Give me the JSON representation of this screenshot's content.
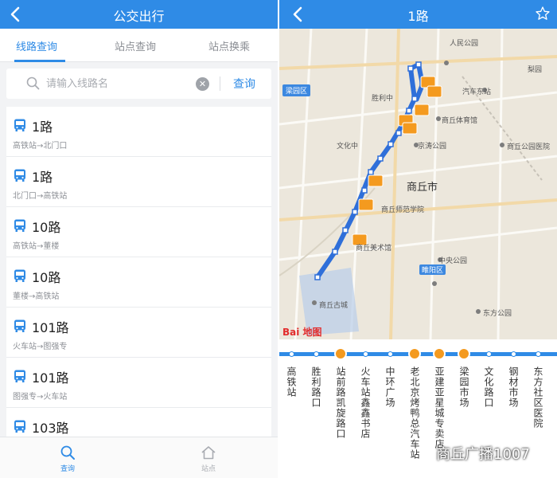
{
  "left": {
    "header": {
      "title": "公交出行"
    },
    "tabs": [
      {
        "label": "线路查询",
        "active": true
      },
      {
        "label": "站点查询",
        "active": false
      },
      {
        "label": "站点换乘",
        "active": false
      }
    ],
    "search": {
      "placeholder": "请输入线路名",
      "value": "",
      "button": "查询"
    },
    "routes": [
      {
        "name": "1路",
        "direction": "高铁站→北门口"
      },
      {
        "name": "1路",
        "direction": "北门口→高铁站"
      },
      {
        "name": "10路",
        "direction": "高铁站→董楼"
      },
      {
        "name": "10路",
        "direction": "董楼→高铁站"
      },
      {
        "name": "101路",
        "direction": "火车站→图强专"
      },
      {
        "name": "101路",
        "direction": "图强专→火车站"
      },
      {
        "name": "103路",
        "direction": ""
      }
    ],
    "bottom_nav": [
      {
        "label": "查询",
        "icon": "search-icon",
        "active": true
      },
      {
        "label": "站点",
        "icon": "home-icon",
        "active": false
      }
    ],
    "accent": "#2f8be6"
  },
  "right": {
    "header": {
      "title": "1路"
    },
    "map": {
      "labels": {
        "district": "梁园区",
        "city": "商丘市",
        "wenhua": "文化中",
        "jiyuan": "京涛公园",
        "yiyuan": "商丘公园医院",
        "jinshijian": "人民公园",
        "cheshi": "汽车东站",
        "zhuanhuan": "商丘体育馆",
        "meishuguan": "商丘美术馆",
        "shifan": "商丘师范学院",
        "gucheng": "商丘古城",
        "zhongxin": "中央公园",
        "dongfang": "东方公园",
        "liyuan": "梨园",
        "shengli": "胜利中"
      },
      "badge_nancheng": "睢阳区",
      "logo_text": "Bai 地图"
    },
    "stops": [
      {
        "name": "高铁站",
        "bus": false
      },
      {
        "name": "胜利路口",
        "bus": false
      },
      {
        "name": "站前路凯旋路口",
        "bus": true
      },
      {
        "name": "火车站鑫鑫书店",
        "bus": false
      },
      {
        "name": "中环广场",
        "bus": false
      },
      {
        "name": "老北京烤鸭总汽车站",
        "bus": true
      },
      {
        "name": "亚建亚星城专卖店",
        "bus": true
      },
      {
        "name": "梁园市场",
        "bus": true
      },
      {
        "name": "文化路口",
        "bus": false
      },
      {
        "name": "钢材市场",
        "bus": false
      },
      {
        "name": "东方社区医院",
        "bus": false
      }
    ],
    "watermark": "商丘广播1007",
    "route_color": "#2f8be6",
    "bus_color": "#f49a1f"
  }
}
